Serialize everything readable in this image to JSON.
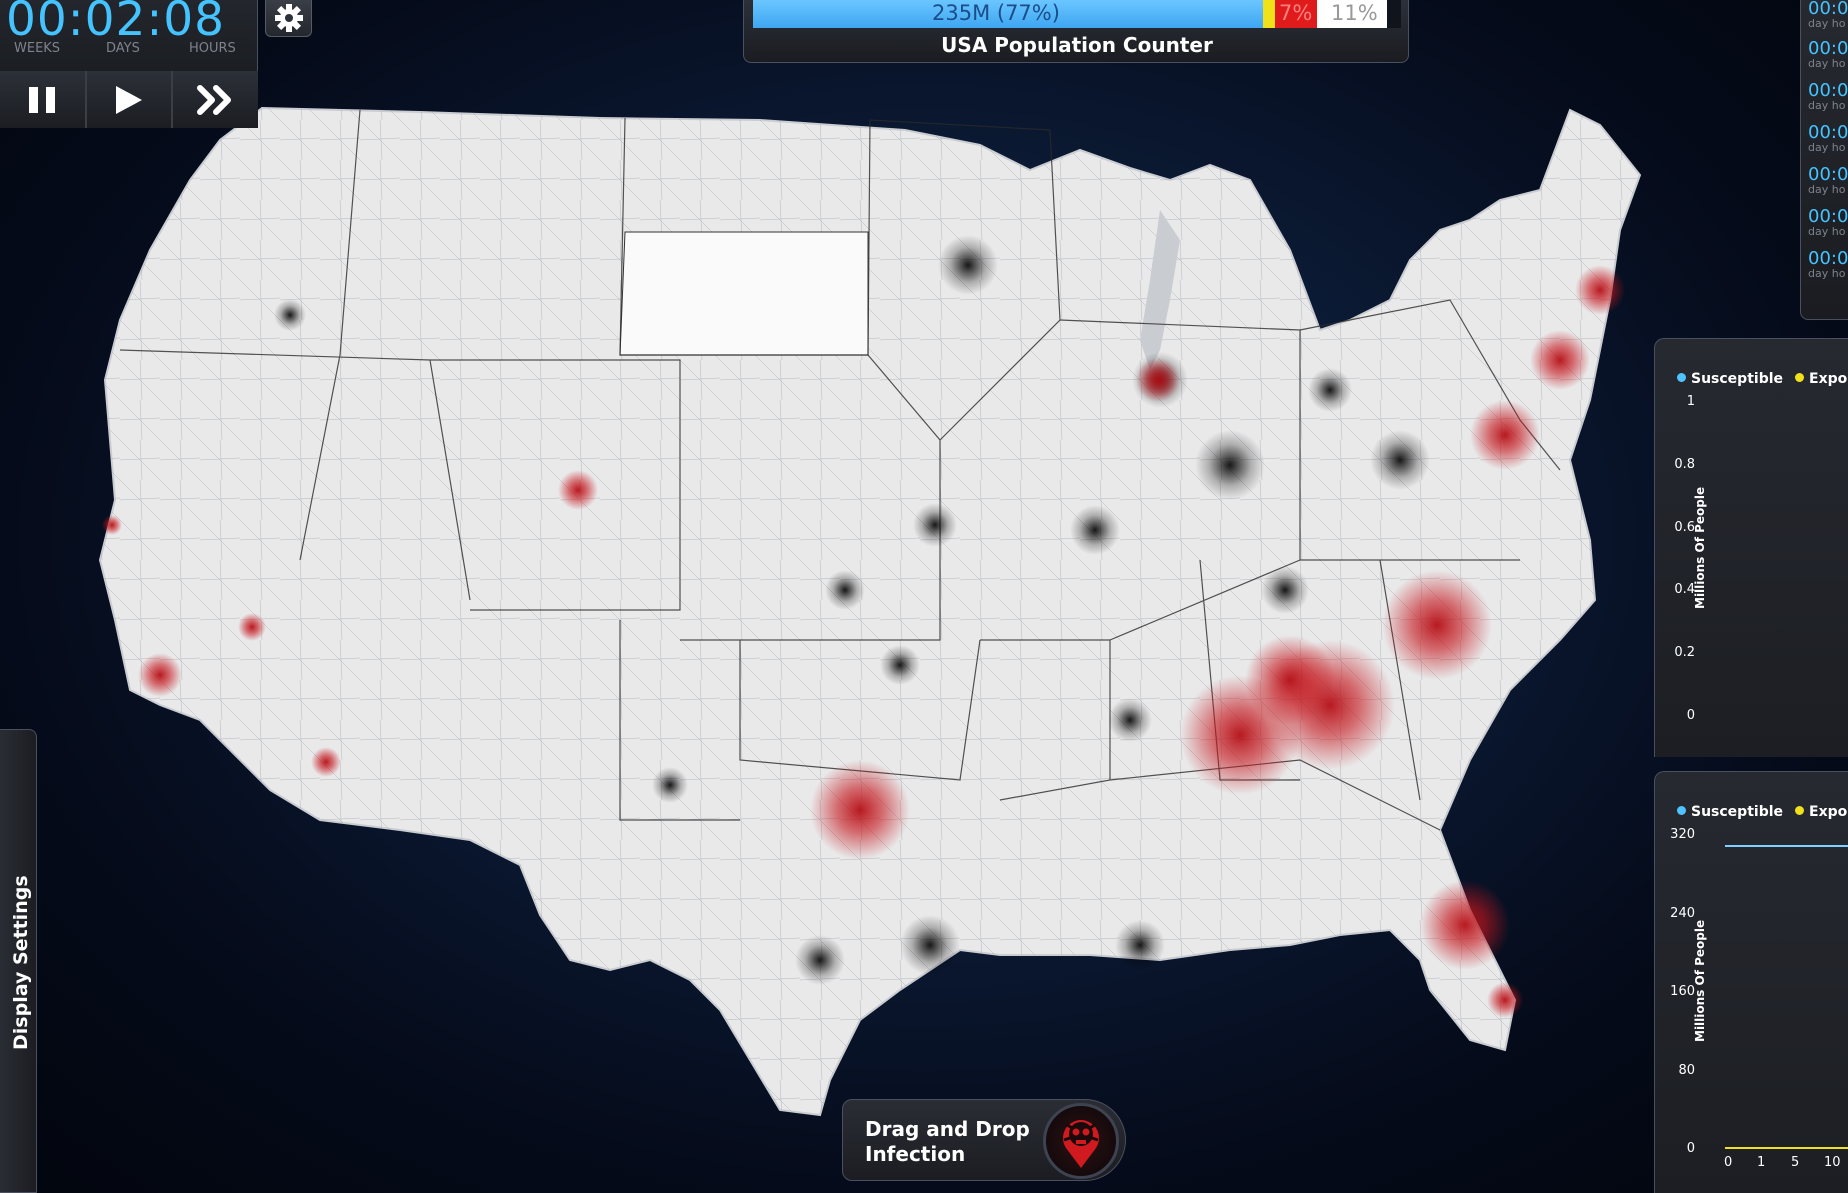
{
  "timer": {
    "clock": "00:02:08",
    "units": [
      "WEEKS",
      "DAYS",
      "HOURS"
    ],
    "controls": [
      "pause-icon",
      "play-icon",
      "fast-forward-icon"
    ]
  },
  "settings": {
    "icon": "gear-icon"
  },
  "population": {
    "title": "USA Population Counter",
    "susceptible_text": "235M (77%)",
    "infected_text": "7%",
    "dead_text": "11%",
    "colors": {
      "susceptible": "#4fb7ff",
      "exposed": "#f0e11a",
      "infected": "#e01b1b",
      "dead": "#ffffff"
    }
  },
  "timelist": [
    {
      "time": "00:0",
      "sub": "day ho"
    },
    {
      "time": "00:0",
      "sub": "day ho"
    },
    {
      "time": "00:0",
      "sub": "day ho"
    },
    {
      "time": "00:0",
      "sub": "day ho"
    },
    {
      "time": "00:0",
      "sub": "day ho"
    },
    {
      "time": "00:0",
      "sub": "day ho"
    },
    {
      "time": "00:0",
      "sub": "day ho"
    }
  ],
  "charts": [
    {
      "legend": [
        {
          "name": "Susceptible",
          "color": "#4fc3ff"
        },
        {
          "name": "Exposed",
          "color": "#f0e11a"
        }
      ],
      "ylabel": "Millions Of People",
      "yticks": [
        "1",
        "0.8",
        "0.6",
        "0.4",
        "0.2",
        "0"
      ]
    },
    {
      "legend": [
        {
          "name": "Susceptible",
          "color": "#4fc3ff"
        },
        {
          "name": "Exposed",
          "color": "#f0e11a"
        }
      ],
      "ylabel": "Millions Of People",
      "yticks": [
        "320",
        "240",
        "160",
        "80",
        "0"
      ],
      "xticks": [
        "0",
        "1",
        "5",
        "10"
      ]
    }
  ],
  "display_settings": {
    "label": "Display Settings"
  },
  "drop": {
    "line1": "Drag and Drop",
    "line2": "Infection",
    "icon": "virus-skull-icon"
  },
  "map": {
    "name": "usa-map",
    "hotspot_color": "#c4161c"
  }
}
